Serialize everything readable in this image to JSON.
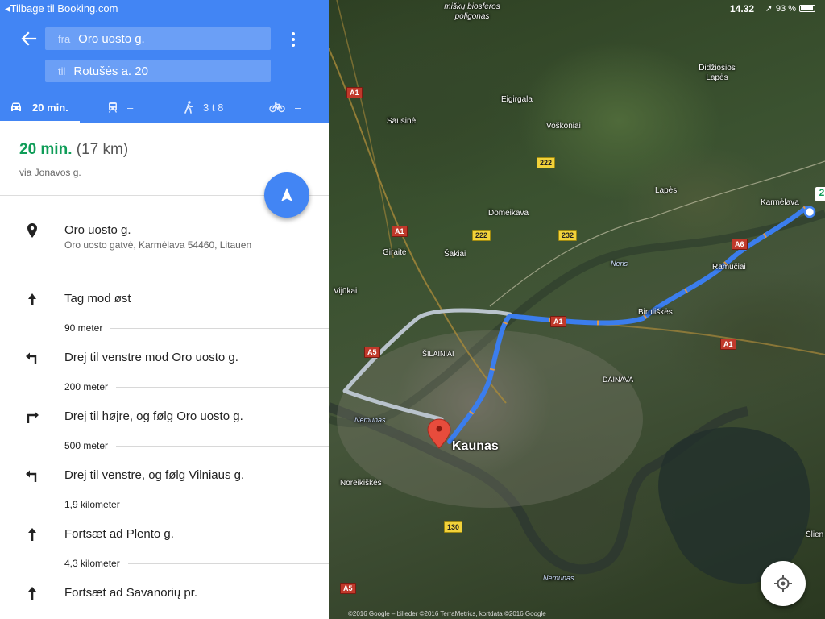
{
  "map": {
    "status_time": "14.32",
    "battery": "93 %",
    "attribution": "©2016 Google – billeder ©2016 TerraMetrics, kortdata ©2016 Google",
    "destination_badge": "2",
    "labels": {
      "top_area": "miškų biosferos poligonas",
      "kaunas": "Kaunas",
      "karmelava": "Karmėlava",
      "didziosios": "Didžiosios Lapės",
      "eigirgala": "Eigirgala",
      "voskoniai": "Voškoniai",
      "sausine": "Sausinė",
      "lapes": "Lapės",
      "domeikava": "Domeikava",
      "giraite": "Giraitė",
      "sakiai": "Šakiai",
      "ramuciai": "Ramučiai",
      "neris": "Neris",
      "vijukai": "Vijūkai",
      "biruliskes": "Biruliškės",
      "silainiai": "ŠILAINIAI",
      "dainava": "DAINAVA",
      "nemunas1": "Nemunas",
      "nemunas2": "Nemunas",
      "noreikiskes": "Noreikiškės",
      "slien": "Šlien"
    },
    "shields": {
      "a1_top": "A1",
      "a1_mid": "A1",
      "a1_route": "A1",
      "a1_right": "A1",
      "r222a": "222",
      "r222b": "222",
      "r232": "232",
      "a6": "A6",
      "a5": "A5",
      "a5b": "A5",
      "r130": "130"
    },
    "colors": {
      "route": "#4285f4",
      "alt_route": "#b9c3cc"
    }
  },
  "header": {
    "back_link": "Tilbage til Booking.com",
    "from_label": "fra",
    "from_value": "Oro uosto g.",
    "to_label": "til",
    "to_value": "Rotušės a. 20",
    "modes": [
      {
        "name": "car",
        "label": "20 min."
      },
      {
        "name": "transit",
        "label": "–"
      },
      {
        "name": "walk",
        "label": "3 t 8"
      },
      {
        "name": "bike",
        "label": "–"
      }
    ]
  },
  "summary": {
    "duration": "20 min.",
    "distance": "(17 km)",
    "via": "via Jonavos g."
  },
  "origin": {
    "name": "Oro uosto g.",
    "address": "Oro uosto gatvė, Karmėlava 54460, Litauen"
  },
  "steps": [
    {
      "icon": "arrow-up-icon",
      "text": "Tag mod øst",
      "distance": "90 meter"
    },
    {
      "icon": "turn-left-icon",
      "text": "Drej til venstre mod Oro uosto g.",
      "distance": "200 meter"
    },
    {
      "icon": "turn-right-icon",
      "text": "Drej til højre, og følg Oro uosto g.",
      "distance": "500 meter"
    },
    {
      "icon": "turn-left-icon",
      "text": "Drej til venstre, og følg Vilniaus g.",
      "distance": "1,9 kilometer"
    },
    {
      "icon": "straight-icon",
      "text": "Fortsæt ad Plento g.",
      "distance": "4,3 kilometer"
    },
    {
      "icon": "straight-icon",
      "text": "Fortsæt ad Savanorių pr.",
      "distance": ""
    }
  ]
}
